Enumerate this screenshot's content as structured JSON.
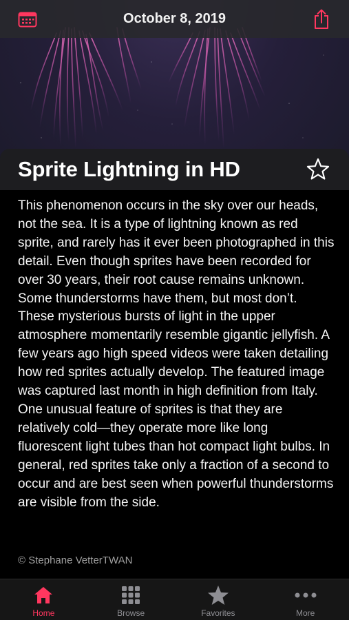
{
  "header": {
    "date": "October 8, 2019",
    "calendar_icon": "calendar-icon",
    "share_icon": "share-icon"
  },
  "article": {
    "title": "Sprite Lightning in HD",
    "favorite_icon": "star-outline-icon",
    "body": "This phenomenon occurs in the sky over our heads, not the sea. It is a type of lightning known as red sprite, and rarely has it ever been photographed in this detail. Even though sprites have been recorded for over 30 years, their root cause remains unknown. Some thunderstorms have them, but most don’t. These mysterious bursts of light in the upper atmosphere momentarily resemble gigantic jellyfish. A few years ago high speed videos were taken detailing how red sprites actually develop. The featured image was captured last month in high definition from Italy. One unusual feature of sprites is that they are relatively cold—they operate more like long fluorescent light tubes than hot compact light bulbs. In general, red sprites take only a fraction of a second to occur and are best seen when powerful thunderstorms are visible from the side.",
    "credit": "© Stephane VetterTWAN"
  },
  "tabs": [
    {
      "label": "Home",
      "icon": "home-icon",
      "active": true
    },
    {
      "label": "Browse",
      "icon": "grid-icon",
      "active": false
    },
    {
      "label": "Favorites",
      "icon": "star-icon",
      "active": false
    },
    {
      "label": "More",
      "icon": "more-dots-icon",
      "active": false
    }
  ],
  "colors": {
    "accent": "#ff375f",
    "inactive": "#8e8e93",
    "background": "#000000"
  }
}
